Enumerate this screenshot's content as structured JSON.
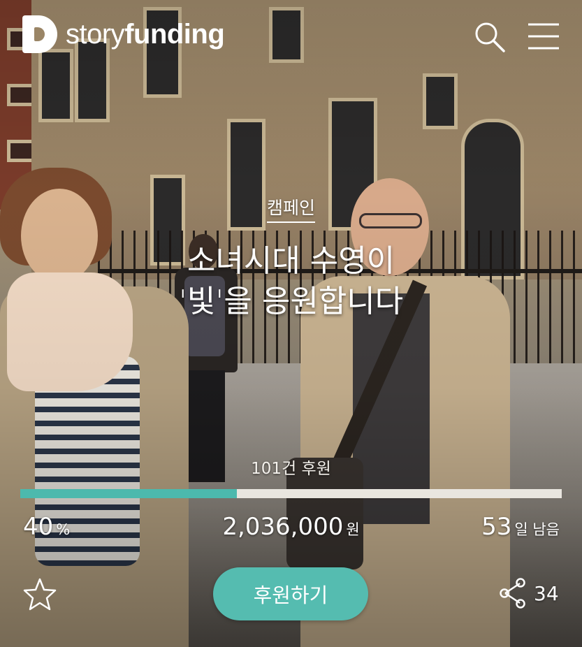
{
  "header": {
    "brand_light": "story",
    "brand_bold": "funding",
    "search_icon": "search-icon",
    "menu_icon": "menu-icon"
  },
  "campaign": {
    "category": "캠페인",
    "title_line1": "소녀시대 수영이",
    "title_line2": "'빛'을 응원합니다"
  },
  "funding": {
    "sponsors": "101건 후원",
    "progress_fraction": 0.4,
    "percent_value": "40",
    "percent_unit": "%",
    "amount_value": "2,036,000",
    "amount_unit": "원",
    "days_value": "53",
    "days_unit": "일 남음"
  },
  "actions": {
    "favorite_icon": "star-icon",
    "support_label": "후원하기",
    "share_icon": "share-icon",
    "share_count": "34"
  },
  "colors": {
    "accent": "#4cb9ad",
    "button": "#55bcb0",
    "track": "#e9e6df",
    "text": "#ffffff"
  }
}
